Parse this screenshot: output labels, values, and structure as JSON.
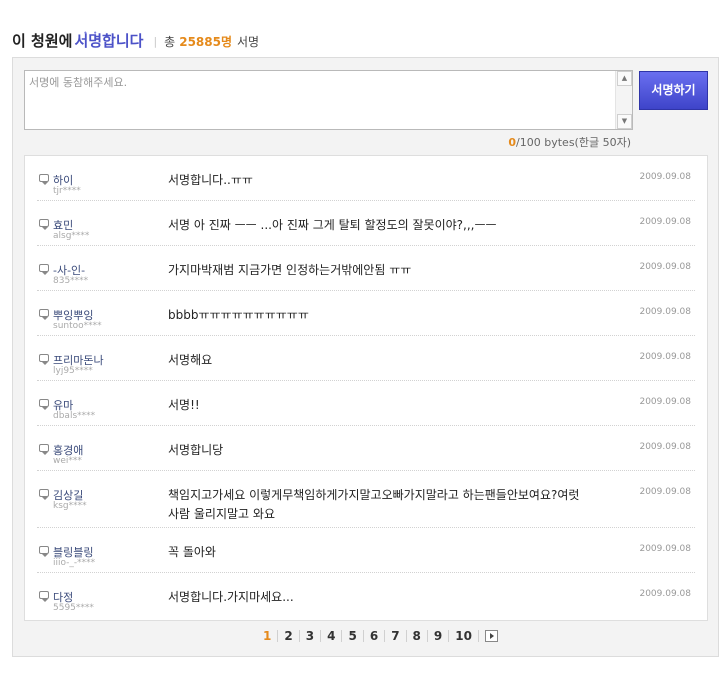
{
  "header": {
    "title_prefix": "이 청원에",
    "title_highlight": "서명합니다",
    "separator": "|",
    "total_label": "총",
    "count": "25885",
    "count_unit": "명",
    "suffix": "서명"
  },
  "form": {
    "placeholder": "서명에 동참해주세요.",
    "submit_label": "서명하기",
    "byte_current": "0",
    "byte_rest": "/100 bytes(한글 50자)"
  },
  "signatures": [
    {
      "nick": "하이",
      "uid": "tjr****",
      "message": "서명합니다..ㅠㅠ",
      "date": "2009.09.08"
    },
    {
      "nick": "효민",
      "uid": "alsg****",
      "message": "서명 아 진짜 ㅡㅡ ...아 진짜 그게 탈퇴 할정도의 잘못이야?,,,ㅡㅡ",
      "date": "2009.09.08"
    },
    {
      "nick": "-사-인-",
      "uid": "835****",
      "message": "가지마박재범 지금가면 인정하는거밖에안됨 ㅠㅠ",
      "date": "2009.09.08"
    },
    {
      "nick": "뿌잉뿌잉",
      "uid": "suntoo****",
      "message": "bbbbㅠㅠㅠㅠㅠㅠㅠㅠㅠㅠ",
      "date": "2009.09.08"
    },
    {
      "nick": "프리마돈나",
      "uid": "lyj95****",
      "message": "서명해요",
      "date": "2009.09.08"
    },
    {
      "nick": "유마",
      "uid": "dbals****",
      "message": "서명!!",
      "date": "2009.09.08"
    },
    {
      "nick": "홍경애",
      "uid": "wei***",
      "message": "서명합니당",
      "date": "2009.09.08"
    },
    {
      "nick": "김상길",
      "uid": "ksg****",
      "message": "책임지고가세요 이렇게무책임하게가지말고오빠가지말라고 하는팬들안보여요?여럿사람 울리지말고 와요",
      "date": "2009.09.08"
    },
    {
      "nick": "블링블링",
      "uid": "iiio-_-****",
      "message": "꼭 돌아와",
      "date": "2009.09.08"
    },
    {
      "nick": "다정",
      "uid": "5595****",
      "message": "서명합니다.가지마세요...",
      "date": "2009.09.08"
    }
  ],
  "pagination": {
    "pages": [
      "1",
      "2",
      "3",
      "4",
      "5",
      "6",
      "7",
      "8",
      "9",
      "10"
    ],
    "current": "1",
    "next_icon": "next-arrow-icon"
  },
  "colors": {
    "accent": "#e58a1b",
    "brand": "#4c52c8",
    "button": "#3e44c9"
  }
}
